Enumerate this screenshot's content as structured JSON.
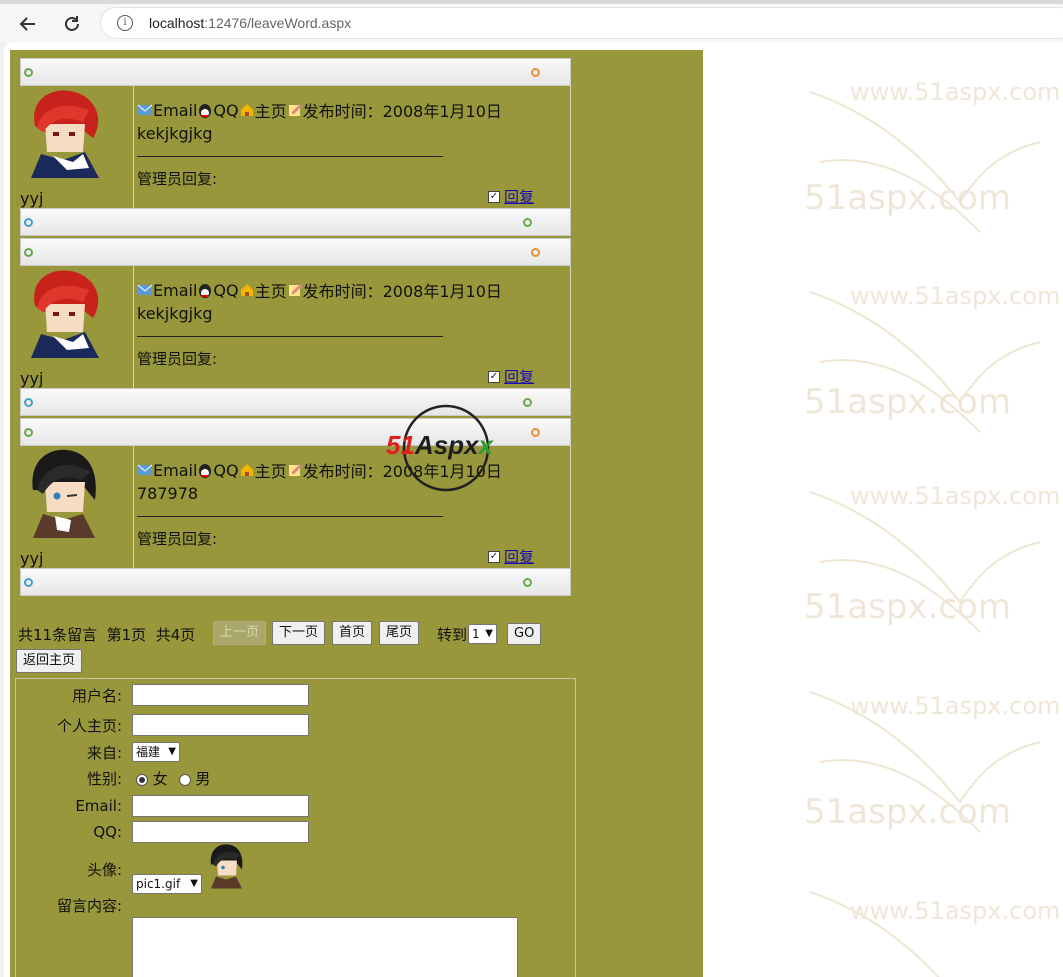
{
  "browser": {
    "url_host": "localhost",
    "url_rest": ":12476/leaveWord.aspx"
  },
  "watermark": {
    "text_url": "www.51aspx.com",
    "text_big": "51aspx.com"
  },
  "messages": [
    {
      "username": "yyj",
      "email": "Email",
      "qq": "QQ",
      "homepage": "主页",
      "time_label": "发布时间：",
      "time": "2008年1月10日",
      "content": "kekjkgjkg",
      "admin_reply_label": "管理员回复:",
      "reply_link": "回复",
      "avatar": "red-hair-avatar"
    },
    {
      "username": "yyj",
      "email": "Email",
      "qq": "QQ",
      "homepage": "主页",
      "time_label": "发布时间：",
      "time": "2008年1月10日",
      "content": "kekjkgjkg",
      "admin_reply_label": "管理员回复:",
      "reply_link": "回复",
      "avatar": "red-hair-avatar"
    },
    {
      "username": "yyj",
      "email": "Email",
      "qq": "QQ",
      "homepage": "主页",
      "time_label": "发布时间：",
      "time": "2008年1月10日",
      "content": "787978",
      "admin_reply_label": "管理员回复:",
      "reply_link": "回复",
      "avatar": "dark-hair-avatar"
    }
  ],
  "pager": {
    "total": "共11条留言",
    "current": "第1页",
    "pages": "共4页",
    "prev": "上一页",
    "next": "下一页",
    "first": "首页",
    "last": "尾页",
    "goto_label": "转到",
    "goto_value": "1",
    "go": "GO",
    "home": "返回主页"
  },
  "form": {
    "username_label": "用户名:",
    "homepage_label": "个人主页:",
    "from_label": "来自:",
    "from_value": "福建",
    "gender_label": "性别:",
    "gender_female": "女",
    "gender_male": "男",
    "email_label": "Email:",
    "qq_label": "QQ:",
    "avatar_label": "头像:",
    "avatar_value": "pic1.gif",
    "content_label": "留言内容:"
  },
  "logo": {
    "text_51": "51",
    "text_aspx": "Aspx"
  },
  "colors": {
    "page_bg": "#98973c",
    "link": "#1a0dab",
    "dot_green": "#6aa84f",
    "dot_orange": "#e69138",
    "dot_blue": "#45a0c6"
  }
}
